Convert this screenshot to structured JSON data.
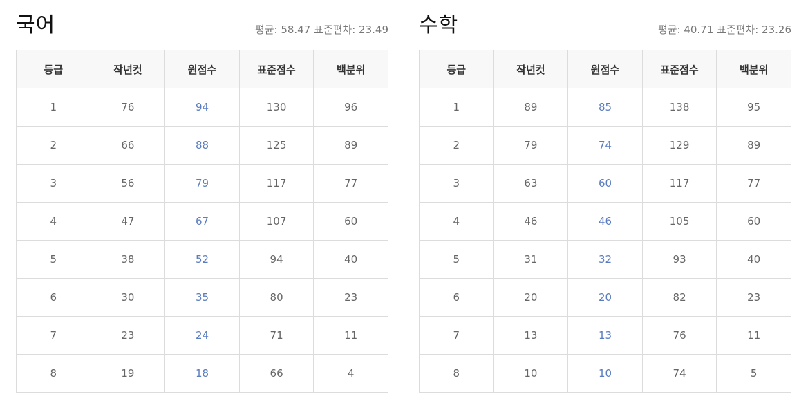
{
  "columns": [
    "등급",
    "작년컷",
    "원점수",
    "표준점수",
    "백분위"
  ],
  "panels": [
    {
      "subject": "국어",
      "stats": "평균: 58.47 표준편차: 23.49",
      "rows": [
        [
          "1",
          "76",
          "94",
          "130",
          "96"
        ],
        [
          "2",
          "66",
          "88",
          "125",
          "89"
        ],
        [
          "3",
          "56",
          "79",
          "117",
          "77"
        ],
        [
          "4",
          "47",
          "67",
          "107",
          "60"
        ],
        [
          "5",
          "38",
          "52",
          "94",
          "40"
        ],
        [
          "6",
          "30",
          "35",
          "80",
          "23"
        ],
        [
          "7",
          "23",
          "24",
          "71",
          "11"
        ],
        [
          "8",
          "19",
          "18",
          "66",
          "4"
        ]
      ]
    },
    {
      "subject": "수학",
      "stats": "평균: 40.71 표준편차: 23.26",
      "rows": [
        [
          "1",
          "89",
          "85",
          "138",
          "95"
        ],
        [
          "2",
          "79",
          "74",
          "129",
          "89"
        ],
        [
          "3",
          "63",
          "60",
          "117",
          "77"
        ],
        [
          "4",
          "46",
          "46",
          "105",
          "60"
        ],
        [
          "5",
          "31",
          "32",
          "93",
          "40"
        ],
        [
          "6",
          "20",
          "20",
          "82",
          "23"
        ],
        [
          "7",
          "13",
          "13",
          "76",
          "11"
        ],
        [
          "8",
          "10",
          "10",
          "74",
          "5"
        ]
      ]
    }
  ],
  "colors": {
    "raw_score": "#5a7cc0",
    "header_bg": "#f8f8f8",
    "border": "#dcdcdc"
  }
}
